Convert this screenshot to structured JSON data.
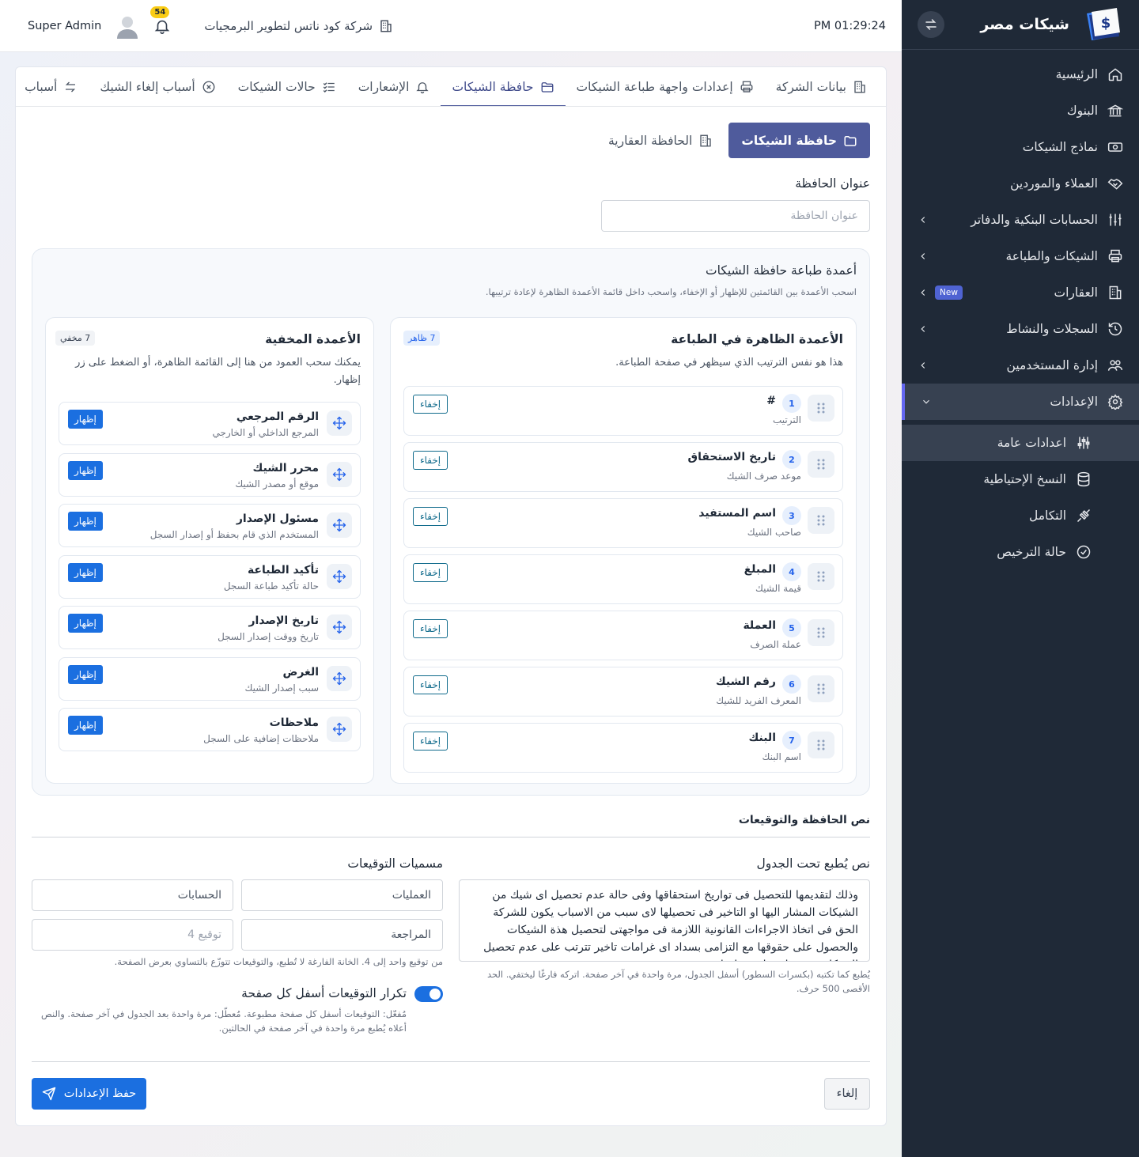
{
  "sidebar": {
    "brand": "شيكات مصر",
    "items": [
      {
        "label": "الرئيسية",
        "icon": "home-icon"
      },
      {
        "label": "البنوك",
        "icon": "bank-icon"
      },
      {
        "label": "نماذج الشيكات",
        "icon": "banknote-icon"
      },
      {
        "label": "العملاء والموردين",
        "icon": "handshake-icon"
      },
      {
        "label": "الحسابات البنكية والدفاتر",
        "icon": "sliders-icon"
      },
      {
        "label": "الشيكات والطباعة",
        "icon": "printer-icon"
      },
      {
        "label": "العقارات",
        "icon": "building-icon",
        "badge": "New"
      },
      {
        "label": "السجلات والنشاط",
        "icon": "history-icon"
      },
      {
        "label": "إدارة المستخدمين",
        "icon": "users-icon"
      },
      {
        "label": "الإعدادات",
        "icon": "gear-icon"
      }
    ],
    "subitems": [
      {
        "label": "اعدادات عامة",
        "icon": "adjust-icon"
      },
      {
        "label": "النسخ الإحتياطية",
        "icon": "database-icon"
      },
      {
        "label": "التكامل",
        "icon": "plug-icon"
      },
      {
        "label": "حالة الترخيص",
        "icon": "check-circle-icon"
      }
    ]
  },
  "topbar": {
    "time": "PM 01:29:24",
    "company": "شركة كود ناتس لتطوير البرمجيات",
    "notifications": "54",
    "user": "Super Admin"
  },
  "tabs": [
    {
      "label": "بيانات الشركة",
      "icon": "building-icon"
    },
    {
      "label": "إعدادات واجهة طباعة الشيكات",
      "icon": "printer-icon"
    },
    {
      "label": "حافظة الشيكات",
      "icon": "folder-open-icon",
      "active": true
    },
    {
      "label": "الإشعارات",
      "icon": "bell-icon"
    },
    {
      "label": "حالات الشيكات",
      "icon": "checklist-icon"
    },
    {
      "label": "أسباب إلغاء الشيك",
      "icon": "x-circle-icon"
    },
    {
      "label": "أسباب",
      "icon": "return-icon"
    }
  ],
  "subtabs": {
    "primary": "حافظة الشيكات",
    "secondary": "الحافظة العقارية"
  },
  "portfolio": {
    "title_label": "عنوان الحافظة",
    "title_placeholder": "عنوان الحافظة"
  },
  "columns_panel": {
    "title": "أعمدة طباعة حافظة الشيكات",
    "subtitle": "اسحب الأعمدة بين القائمتين للإظهار أو الإخفاء، واسحب داخل قائمة الأعمدة الظاهرة لإعادة ترتيبها.",
    "visible": {
      "title": "الأعمدة الظاهرة في الطباعة",
      "subtitle": "هذا هو نفس الترتيب الذي سيظهر في صفحة الطباعة.",
      "badge": "7 ظاهر",
      "hide_label": "إخفاء",
      "rows": [
        {
          "num": "1",
          "name": "#",
          "desc": "الترتيب"
        },
        {
          "num": "2",
          "name": "تاريخ الاستحقاق",
          "desc": "موعد صرف الشيك"
        },
        {
          "num": "3",
          "name": "اسم المستفيد",
          "desc": "صاحب الشيك"
        },
        {
          "num": "4",
          "name": "المبلغ",
          "desc": "قيمة الشيك"
        },
        {
          "num": "5",
          "name": "العملة",
          "desc": "عملة الصرف"
        },
        {
          "num": "6",
          "name": "رقم الشيك",
          "desc": "المعرف الفريد للشيك"
        },
        {
          "num": "7",
          "name": "البنك",
          "desc": "اسم البنك"
        }
      ]
    },
    "hidden": {
      "title": "الأعمدة المخفية",
      "subtitle": "يمكنك سحب العمود من هنا إلى القائمة الظاهرة، أو الضغط على زر إظهار.",
      "badge": "7 مخفي",
      "show_label": "إظهار",
      "rows": [
        {
          "name": "الرقم المرجعي",
          "desc": "المرجع الداخلي أو الخارجي"
        },
        {
          "name": "محرر الشيك",
          "desc": "موقع أو مصدر الشيك"
        },
        {
          "name": "مسئول الإصدار",
          "desc": "المستخدم الذي قام بحفظ أو إصدار السجل"
        },
        {
          "name": "تأكيد الطباعة",
          "desc": "حالة تأكيد طباعة السجل"
        },
        {
          "name": "تاريخ الإصدار",
          "desc": "تاريخ ووقت إصدار السجل"
        },
        {
          "name": "الغرض",
          "desc": "سبب إصدار الشيك"
        },
        {
          "name": "ملاحظات",
          "desc": "ملاحظات إضافية على السجل"
        }
      ]
    }
  },
  "signatures": {
    "section_title": "نص الحافظة والتوقيعات",
    "footer_text_label": "نص يُطبع تحت الجدول",
    "footer_text": "وذلك لتقديمها للتحصيل فى تواريخ استحقاقها وفى حالة عدم تحصيل اى شيك من الشيكات المشار اليها او التاخير فى تحصيلها لاى سبب من الاسباب يكون للشركة الحق فى اتخاذ الاجراءات القانونية اللازمة فى مواجهتى لتحصيل هذة الشيكات والحصول على حقوقها مع التزامى بسداد اى غرامات تاخير تترتب على عدم تحصيل الشيكات فى تواريخ استحقاقها",
    "footer_hint": "يُطبع كما تكتبه (بكسرات السطور) أسفل الجدول، مرة واحدة في آخر صفحة. اتركه فارغًا ليختفي. الحد الأقصى 500 حرف.",
    "names_label": "مسميات التوقيعات",
    "names": [
      "العمليات",
      "الحسابات",
      "المراجعة"
    ],
    "fourth_placeholder": "توقيع 4",
    "names_hint": "من توقيع واحد إلى 4. الخانة الفارغة لا تُطبع، والتوقيعات تتوزّع بالتساوي بعرض الصفحة.",
    "repeat_label": "تكرار التوقيعات أسفل كل صفحة",
    "repeat_hint": "مُفعّل: التوقيعات أسفل كل صفحة مطبوعة. مُعطّل: مرة واحدة بعد الجدول في آخر صفحة. والنص أعلاه يُطبع مرة واحدة في آخر صفحة في الحالتين."
  },
  "actions": {
    "save": "حفظ الإعدادات",
    "cancel": "إلغاء"
  },
  "colors": {
    "sidebar_bg": "#1f2937",
    "primary": "#4f5b9c",
    "accent": "#1b6fe0",
    "notify": "#facc15"
  }
}
